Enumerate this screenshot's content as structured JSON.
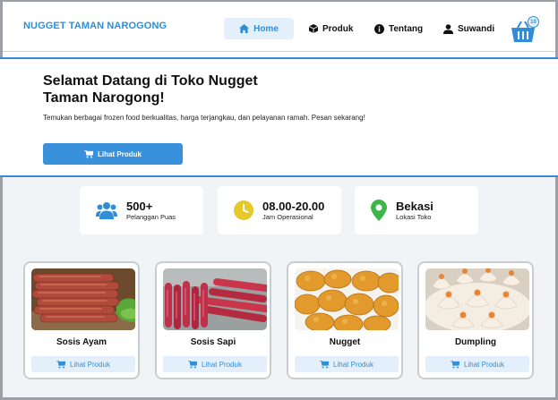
{
  "brand": "NUGGET TAMAN NAROGONG",
  "nav": {
    "home": "Home",
    "produk": "Produk",
    "tentang": "Tentang",
    "user": "Suwandi",
    "cart_count": "10"
  },
  "hero": {
    "title": "Selamat Datang di Toko Nugget Taman Narogong!",
    "desc": "Temukan berbagai frozen food berkualitas, harga terjangkau, dan pelayanan ramah. Pesan sekarang!",
    "button": "Lihat Produk"
  },
  "stats": [
    {
      "value": "500+",
      "label": "Pelanggan Puas",
      "icon": "users-icon"
    },
    {
      "value": "08.00-20.00",
      "label": "Jam Operasional",
      "icon": "clock-icon"
    },
    {
      "value": "Bekasi",
      "label": "Lokasi Toko",
      "icon": "location-pin-icon"
    }
  ],
  "products": [
    {
      "name": "Sosis Ayam",
      "button": "Lihat Produk"
    },
    {
      "name": "Sosis Sapi",
      "button": "Lihat Produk"
    },
    {
      "name": "Nugget",
      "button": "Lihat Produk"
    },
    {
      "name": "Dumpling",
      "button": "Lihat Produk"
    }
  ],
  "colors": {
    "accent": "#2f8ed6",
    "button": "#3a91db",
    "light_accent": "#e3f0fb",
    "clock": "#e5c92b",
    "pin": "#3cb54a"
  }
}
